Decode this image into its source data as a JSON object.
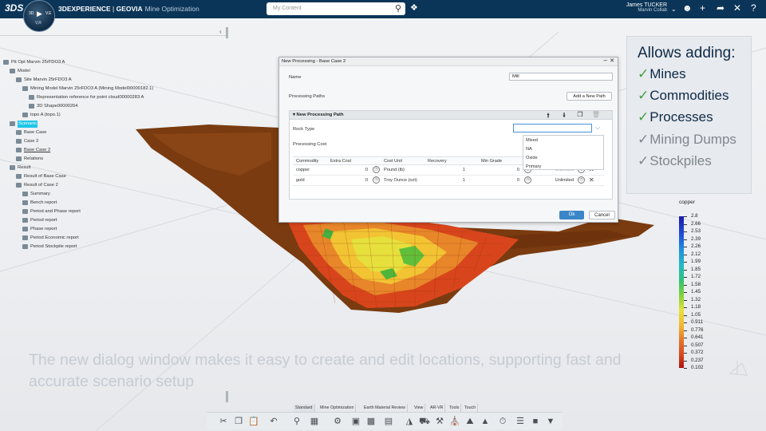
{
  "app": {
    "logo": "3DS",
    "brand": "3DEXPERIENCE",
    "suite": "GEOVIA",
    "product": "Mine Optimization",
    "compass": {
      "left": "3D",
      "right": "V.E",
      "version": "V,R"
    },
    "search_placeholder": "My Content",
    "user_name": "James TUCKER",
    "user_collab": "Marvin Collab"
  },
  "tree": [
    {
      "label": "Pit Opt Marvin 25rFDO3 A",
      "icon": "pit-icon"
    },
    {
      "label": "Model",
      "icon": "model-icon"
    },
    {
      "label": "Site Marvin 25rFDO3 A",
      "icon": "site-icon"
    },
    {
      "label": "Mining Model Marvin 25rFDO3 A (Mining Model00000182.1)",
      "icon": "mining-model-icon"
    },
    {
      "label": "Representation reference for point cloud00000283 A",
      "icon": "point-cloud-icon"
    },
    {
      "label": "3D Shape00000264",
      "icon": "shape-icon"
    },
    {
      "label": "topo A (topo.1)",
      "icon": "topo-icon"
    },
    {
      "label": "Scenario",
      "icon": "scenario-icon"
    },
    {
      "label": "Base Case",
      "icon": "case-icon"
    },
    {
      "label": "Case 2",
      "icon": "case-icon"
    },
    {
      "label": "Base Case 2",
      "icon": "case-icon"
    },
    {
      "label": "Relations",
      "icon": "relations-icon"
    },
    {
      "label": "Result",
      "icon": "result-icon"
    },
    {
      "label": "Result of Base Case",
      "icon": "result-icon"
    },
    {
      "label": "Result of Case 2",
      "icon": "result-icon"
    },
    {
      "label": "Summary",
      "icon": "report-icon"
    },
    {
      "label": "Bench report",
      "icon": "report-icon"
    },
    {
      "label": "Period and Phase report",
      "icon": "report-icon"
    },
    {
      "label": "Period report",
      "icon": "report-icon"
    },
    {
      "label": "Phase report",
      "icon": "report-icon"
    },
    {
      "label": "Period Economic report",
      "icon": "report-icon"
    },
    {
      "label": "Period Stockpile report",
      "icon": "report-icon"
    }
  ],
  "dialog": {
    "title": "New Processing - Base Case 2",
    "name_label": "Name",
    "name_value": "Mill",
    "paths_label": "Processing Paths",
    "add_path": "Add a New Path",
    "path_title": "New Processing Path",
    "rock_type_label": "Rock Type",
    "rock_type_value": "",
    "rock_type_options": [
      "Mixed",
      "NA",
      "Oxide",
      "Primary"
    ],
    "cost_label": "Processing Cost",
    "columns": [
      "Commodity",
      "Extra Cost",
      "Cost Unit",
      "Recovery",
      "Min Grade"
    ],
    "rows": [
      {
        "commodity": "copper",
        "extra_cost": "0",
        "cost_unit": "Pound (lb)",
        "recovery": "1",
        "min_grade": "0",
        "max": "Unlimited"
      },
      {
        "commodity": "gold",
        "extra_cost": "0",
        "cost_unit": "Troy Ounce (ozt)",
        "recovery": "1",
        "min_grade": "0",
        "max": "Unlimited"
      }
    ],
    "ok": "Ok",
    "cancel": "Cancel"
  },
  "callout": {
    "heading": "Allows adding:",
    "items": [
      {
        "label": "Mines",
        "highlight": true
      },
      {
        "label": "Commodities",
        "highlight": true
      },
      {
        "label": "Processes",
        "highlight": true
      },
      {
        "label": "Mining Dumps",
        "highlight": false
      },
      {
        "label": "Stockpiles",
        "highlight": false
      }
    ]
  },
  "legend": {
    "title": "copper",
    "values": [
      "2.8",
      "2.66",
      "2.53",
      "2.39",
      "2.26",
      "2.12",
      "1.99",
      "1.85",
      "1.72",
      "1.58",
      "1.45",
      "1.32",
      "1.18",
      "1.05",
      "0.911",
      "0.776",
      "0.641",
      "0.507",
      "0.372",
      "0.237",
      "0.102"
    ]
  },
  "caption": "The new dialog window makes it easy to create and edit locations, supporting fast and accurate scenario setup",
  "toolbar_tabs": [
    "Standard",
    "Mine Optimization",
    "Earth Material Review",
    "View",
    "AR-VR",
    "Tools",
    "Touch"
  ],
  "colors": {
    "topbar": "#0b3558",
    "accent": "#3a86c8",
    "check_green": "#3fa33f",
    "selection": "#1ec6e6"
  }
}
